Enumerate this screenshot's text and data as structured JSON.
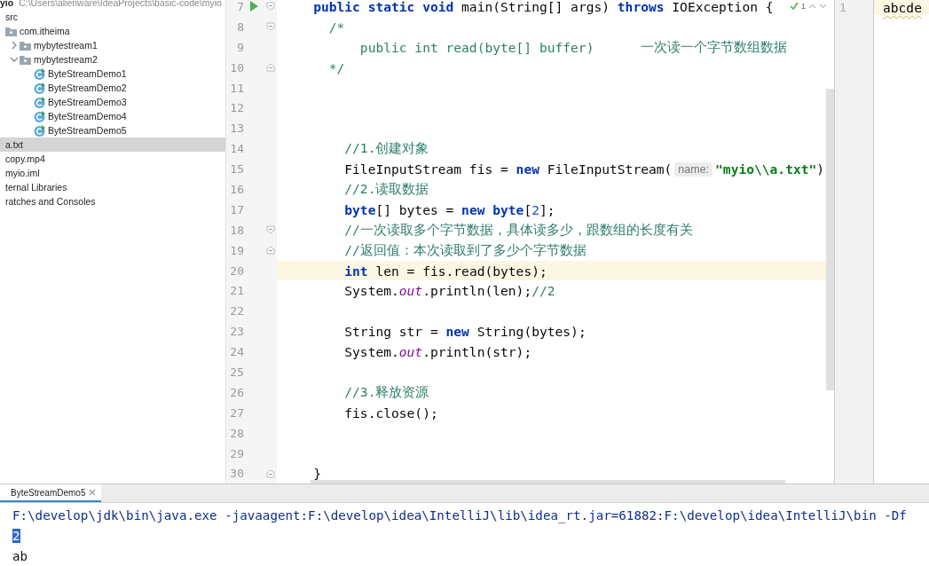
{
  "project_panel": {
    "root_name": "yio",
    "root_path": "C:\\Users\\alienware\\IdeaProjects\\basic-code\\myio",
    "items": [
      {
        "label": "src",
        "selected": false,
        "children": [
          {
            "label": "com.itheima",
            "kind": "package",
            "selected": false,
            "children": [
              {
                "label": "mybytestream1",
                "kind": "package",
                "expanded": false,
                "selected": false
              },
              {
                "label": "mybytestream2",
                "kind": "package",
                "expanded": true,
                "selected": false,
                "children": [
                  {
                    "label": "ByteStreamDemo1",
                    "kind": "class",
                    "selected": false
                  },
                  {
                    "label": "ByteStreamDemo2",
                    "kind": "class",
                    "selected": false
                  },
                  {
                    "label": "ByteStreamDemo3",
                    "kind": "class",
                    "selected": false
                  },
                  {
                    "label": "ByteStreamDemo4",
                    "kind": "class",
                    "selected": false
                  },
                  {
                    "label": "ByteStreamDemo5",
                    "kind": "class",
                    "selected": false
                  }
                ]
              }
            ]
          }
        ]
      },
      {
        "label": "a.txt",
        "selected": true
      },
      {
        "label": "copy.mp4",
        "selected": false
      },
      {
        "label": "myio.iml",
        "selected": false
      },
      {
        "label": "ternal Libraries",
        "selected": false
      },
      {
        "label": "ratches and Consoles",
        "selected": false
      }
    ]
  },
  "editor": {
    "inspection": {
      "count": "1"
    },
    "lines": [
      {
        "number": "7",
        "run": true,
        "fold_start": true,
        "fold_end": false,
        "current": false,
        "segments": [
          {
            "text": "    public static void",
            "kind": "keyword"
          },
          {
            "text": " main(String[] args) ",
            "kind": "plain"
          },
          {
            "text": "throws",
            "kind": "keyword"
          },
          {
            "text": " IOException {",
            "kind": "plain"
          }
        ]
      },
      {
        "number": "8",
        "run": false,
        "fold_start": true,
        "fold_end": false,
        "current": false,
        "segments": [
          {
            "text": "      /*",
            "kind": "comment"
          }
        ]
      },
      {
        "number": "9",
        "run": false,
        "fold_start": false,
        "fold_end": false,
        "current": false,
        "segments": [
          {
            "text": "          public int read(byte[] buffer)",
            "kind": "comment"
          },
          {
            "text": "      一次读一个字节数组数据",
            "kind": "comment"
          }
        ]
      },
      {
        "number": "10",
        "run": false,
        "fold_start": false,
        "fold_end": true,
        "current": false,
        "segments": [
          {
            "text": "      */",
            "kind": "comment"
          }
        ]
      },
      {
        "number": "11",
        "run": false,
        "fold_start": false,
        "fold_end": false,
        "current": false
      },
      {
        "number": "12",
        "run": false,
        "fold_start": false,
        "fold_end": false,
        "current": false
      },
      {
        "number": "13",
        "run": false,
        "fold_start": false,
        "fold_end": false,
        "current": false
      },
      {
        "number": "14",
        "run": false,
        "fold_start": false,
        "fold_end": false,
        "current": false,
        "segments": [
          {
            "text": "        //1.创建对象",
            "kind": "comment"
          }
        ]
      },
      {
        "number": "15",
        "run": false,
        "fold_start": false,
        "fold_end": false,
        "current": false,
        "segments": [
          {
            "text": "        FileInputStream fis = ",
            "kind": "plain"
          },
          {
            "text": "new",
            "kind": "keyword"
          },
          {
            "text": " FileInputStream(",
            "kind": "plain"
          },
          {
            "text": "name:",
            "kind": "hint"
          },
          {
            "text": "\"myio\\\\a.txt\"",
            "kind": "string"
          },
          {
            "text": ")",
            "kind": "plain"
          }
        ]
      },
      {
        "number": "16",
        "run": false,
        "fold_start": false,
        "fold_end": false,
        "current": false,
        "segments": [
          {
            "text": "        //2.读取数据",
            "kind": "comment"
          }
        ]
      },
      {
        "number": "17",
        "run": false,
        "fold_start": false,
        "fold_end": false,
        "current": false,
        "segments": [
          {
            "text": "        byte",
            "kind": "keyword"
          },
          {
            "text": "[] bytes = ",
            "kind": "plain"
          },
          {
            "text": "new byte",
            "kind": "keyword"
          },
          {
            "text": "[",
            "kind": "plain"
          },
          {
            "text": "2",
            "kind": "number"
          },
          {
            "text": "];",
            "kind": "plain"
          }
        ]
      },
      {
        "number": "18",
        "run": false,
        "fold_start": true,
        "fold_end": false,
        "current": false,
        "segments": [
          {
            "text": "        //一次读取多个字节数据，具体读多少，跟数组的长度有关",
            "kind": "comment"
          }
        ]
      },
      {
        "number": "19",
        "run": false,
        "fold_start": false,
        "fold_end": true,
        "current": false,
        "segments": [
          {
            "text": "        //返回值：本次读取到了多少个字节数据",
            "kind": "comment"
          }
        ]
      },
      {
        "number": "20",
        "run": false,
        "fold_start": false,
        "fold_end": false,
        "current": true,
        "segments": [
          {
            "text": "        int",
            "kind": "keyword"
          },
          {
            "text": " len = fis.read(bytes);",
            "kind": "plain"
          }
        ]
      },
      {
        "number": "21",
        "run": false,
        "fold_start": false,
        "fold_end": false,
        "current": false,
        "segments": [
          {
            "text": "        System.",
            "kind": "plain"
          },
          {
            "text": "out",
            "kind": "field"
          },
          {
            "text": ".println(len);",
            "kind": "plain"
          },
          {
            "text": "//2",
            "kind": "comment"
          }
        ]
      },
      {
        "number": "22",
        "run": false,
        "fold_start": false,
        "fold_end": false,
        "current": false
      },
      {
        "number": "23",
        "run": false,
        "fold_start": false,
        "fold_end": false,
        "current": false,
        "segments": [
          {
            "text": "        String str = ",
            "kind": "plain"
          },
          {
            "text": "new",
            "kind": "keyword"
          },
          {
            "text": " String(bytes);",
            "kind": "plain"
          }
        ]
      },
      {
        "number": "24",
        "run": false,
        "fold_start": false,
        "fold_end": false,
        "current": false,
        "segments": [
          {
            "text": "        System.",
            "kind": "plain"
          },
          {
            "text": "out",
            "kind": "field"
          },
          {
            "text": ".println(str);",
            "kind": "plain"
          }
        ]
      },
      {
        "number": "25",
        "run": false,
        "fold_start": false,
        "fold_end": false,
        "current": false
      },
      {
        "number": "26",
        "run": false,
        "fold_start": false,
        "fold_end": false,
        "current": false,
        "segments": [
          {
            "text": "        //3.释放资源",
            "kind": "comment"
          }
        ]
      },
      {
        "number": "27",
        "run": false,
        "fold_start": false,
        "fold_end": false,
        "current": false,
        "segments": [
          {
            "text": "        fis.close();",
            "kind": "plain"
          }
        ]
      },
      {
        "number": "28",
        "run": false,
        "fold_start": false,
        "fold_end": false,
        "current": false
      },
      {
        "number": "29",
        "run": false,
        "fold_start": false,
        "fold_end": false,
        "current": false
      },
      {
        "number": "30",
        "run": false,
        "fold_start": false,
        "fold_end": true,
        "current": false,
        "segments": [
          {
            "text": "    }",
            "kind": "plain"
          }
        ]
      }
    ]
  },
  "text_file": {
    "lines": [
      {
        "number": "1",
        "text": "abcde",
        "current": true
      }
    ]
  },
  "run_panel": {
    "tab": {
      "label": "ByteStreamDemo5",
      "selected": true
    },
    "lines": [
      {
        "text": "F:\\develop\\jdk\\bin\\java.exe -javaagent:F:\\develop\\idea\\IntelliJ\\lib\\idea_rt.jar=61882:F:\\develop\\idea\\IntelliJ\\bin -Df",
        "kind": "command",
        "selected": false
      },
      {
        "text": "2",
        "kind": "output",
        "selected": true
      },
      {
        "text": "ab",
        "kind": "output",
        "selected": false
      }
    ]
  }
}
